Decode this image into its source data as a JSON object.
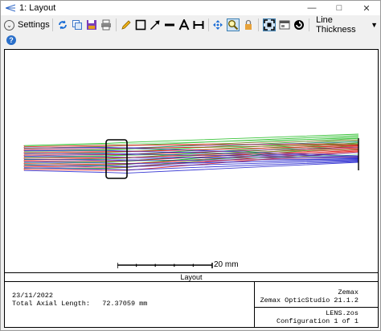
{
  "window": {
    "title": "1: Layout"
  },
  "toolbar": {
    "settings_label": "Settings",
    "line_thickness_label": "Line Thickness",
    "icons": [
      "refresh-icon",
      "copy-icon",
      "save-icon",
      "print-icon",
      "pencil-icon",
      "rectangle-icon",
      "arrow-icon",
      "line-icon",
      "text-icon",
      "dimension-icon",
      "move-icon",
      "zoom-icon",
      "lock-icon",
      "fit-icon",
      "window-icon",
      "rotate-icon"
    ]
  },
  "plot": {
    "scale_label": "20 mm",
    "caption": "Layout",
    "date": "23/11/2022",
    "axial_label": "Total Axial Length:",
    "axial_value": "72.37059 mm",
    "company": "Zemax",
    "product": "Zemax OpticStudio 21.1.2",
    "file": "LENS.zos",
    "configuration": "Configuration 1 of 1",
    "ray_colors": {
      "field1": "#1a1acc",
      "field2": "#18b818",
      "field3": "#e01010"
    }
  }
}
